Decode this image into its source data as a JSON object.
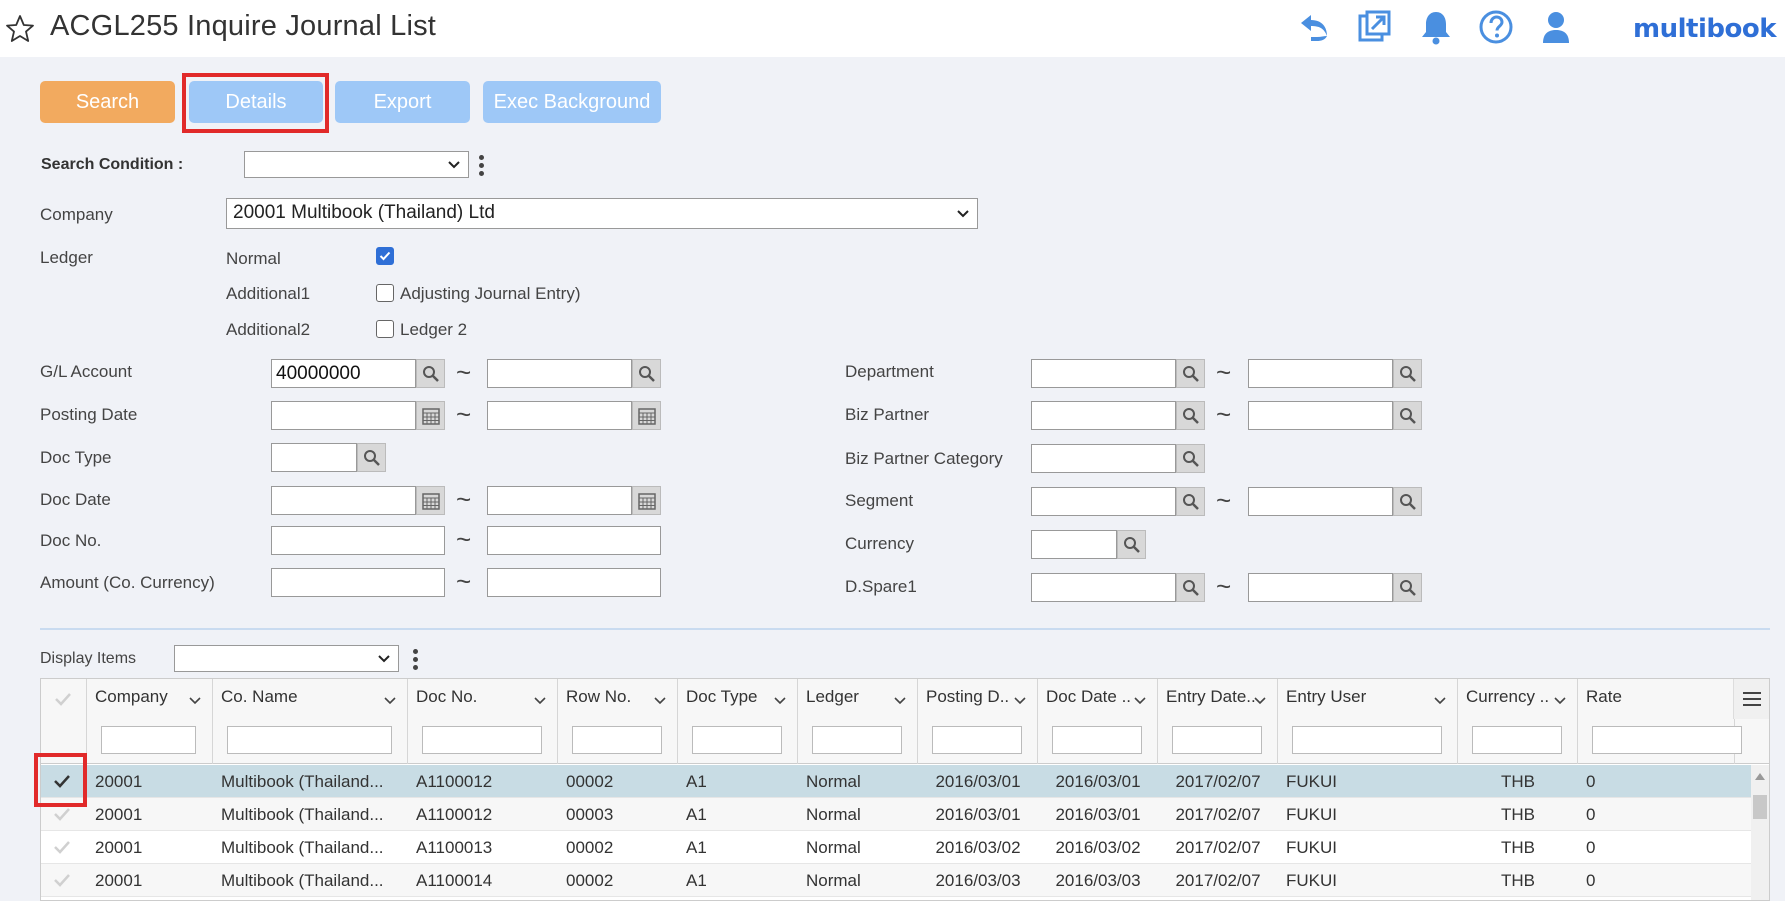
{
  "header": {
    "title": "ACGL255 Inquire Journal List",
    "brand": "multibook",
    "brand_color": "#2f6fd6",
    "icons": [
      "star-icon",
      "undo-icon",
      "popout-icon",
      "bell-icon",
      "help-icon",
      "user-icon"
    ]
  },
  "toolbar": {
    "search_label": "Search",
    "details_label": "Details",
    "export_label": "Export",
    "exec_background_label": "Exec Background"
  },
  "form": {
    "search_condition_label": "Search Condition :",
    "search_condition_value": "",
    "company_label": "Company",
    "company_value": "20001 Multibook (Thailand) Ltd",
    "ledger_label": "Ledger",
    "ledger_normal_label": "Normal",
    "ledger_normal_checked": true,
    "ledger_additional1_label": "Additional1",
    "ledger_additional1_text": "Adjusting Journal Entry)",
    "ledger_additional1_checked": false,
    "ledger_additional2_label": "Additional2",
    "ledger_additional2_text": "Ledger 2",
    "ledger_additional2_checked": false,
    "gl_account_label": "G/L Account",
    "gl_account_from": "40000000",
    "gl_account_to": "",
    "posting_date_label": "Posting Date",
    "doc_type_label": "Doc Type",
    "doc_date_label": "Doc Date",
    "doc_no_label": "Doc No.",
    "amount_label": "Amount (Co. Currency)",
    "department_label": "Department",
    "biz_partner_label": "Biz Partner",
    "biz_partner_category_label": "Biz Partner Category",
    "segment_label": "Segment",
    "currency_label": "Currency",
    "dspare1_label": "D.Spare1",
    "range_separator": "~"
  },
  "grid": {
    "display_items_label": "Display Items",
    "display_items_value": "",
    "columns": [
      "Company",
      "Co. Name",
      "Doc No.",
      "Row No.",
      "Doc Type",
      "Ledger",
      "Posting D..",
      "Doc Date ..",
      "Entry Date..",
      "Entry User",
      "Currency ..",
      "Rate"
    ],
    "rows": [
      {
        "checked": true,
        "cells": [
          "20001",
          "Multibook (Thailand...",
          "A1100012",
          "00002",
          "A1",
          "Normal",
          "2016/03/01",
          "2016/03/01",
          "2017/02/07",
          "FUKUI",
          "THB",
          "0"
        ]
      },
      {
        "checked": false,
        "cells": [
          "20001",
          "Multibook (Thailand...",
          "A1100012",
          "00003",
          "A1",
          "Normal",
          "2016/03/01",
          "2016/03/01",
          "2017/02/07",
          "FUKUI",
          "THB",
          "0"
        ]
      },
      {
        "checked": false,
        "cells": [
          "20001",
          "Multibook (Thailand...",
          "A1100013",
          "00002",
          "A1",
          "Normal",
          "2016/03/02",
          "2016/03/02",
          "2017/02/07",
          "FUKUI",
          "THB",
          "0"
        ]
      },
      {
        "checked": false,
        "cells": [
          "20001",
          "Multibook (Thailand...",
          "A1100014",
          "00002",
          "A1",
          "Normal",
          "2016/03/03",
          "2016/03/03",
          "2017/02/07",
          "FUKUI",
          "THB",
          "0"
        ]
      }
    ]
  },
  "colors": {
    "search_button": "#f2aa5f",
    "secondary_button": "#9ec8f7",
    "highlight": "#e12a2a",
    "selected_row": "#c8dce4"
  }
}
